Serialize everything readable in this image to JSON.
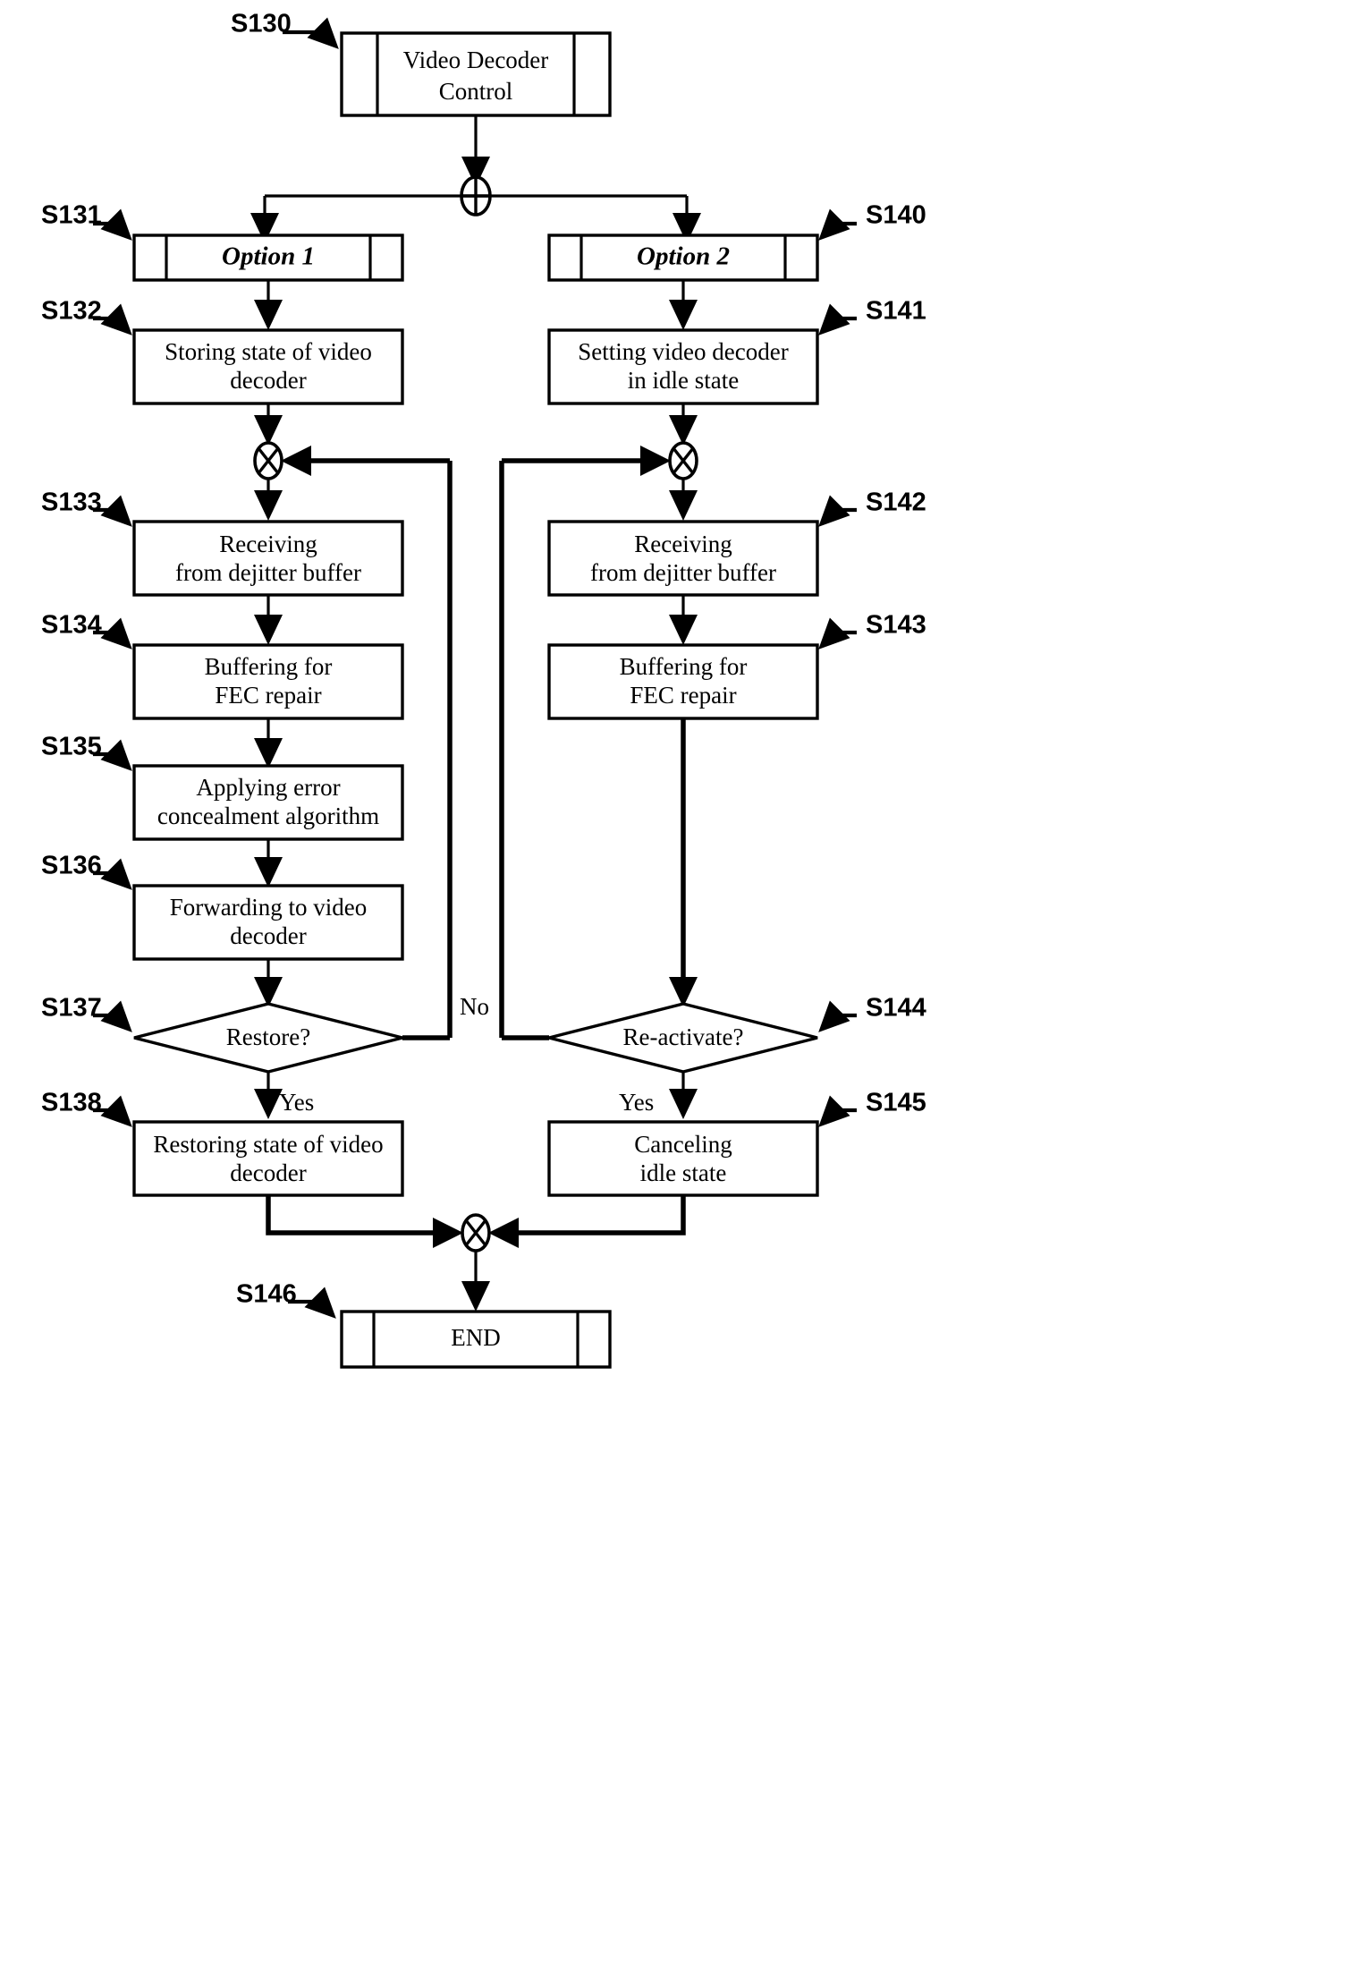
{
  "figure": {
    "type": "patent-flowchart",
    "title": "Video Decoder Control flowchart",
    "colors": {
      "stroke": "#000000",
      "fill": "#ffffff",
      "text": "#000000"
    }
  },
  "nodes": {
    "start": {
      "id": "S130",
      "label_line1": "Video Decoder",
      "label_line2": "Control",
      "shape": "terminal"
    },
    "option1": {
      "id": "S131",
      "label": "Option 1",
      "shape": "terminal"
    },
    "option2": {
      "id": "S140",
      "label": "Option 2",
      "shape": "terminal"
    },
    "store_state": {
      "id": "S132",
      "label_line1": "Storing state of video",
      "label_line2": "decoder",
      "shape": "process"
    },
    "set_idle": {
      "id": "S141",
      "label_line1": "Setting video decoder",
      "label_line2": "in idle state",
      "shape": "process"
    },
    "recv_left": {
      "id": "S133",
      "label_line1": "Receiving",
      "label_line2": "from dejitter buffer",
      "shape": "process"
    },
    "recv_right": {
      "id": "S142",
      "label_line1": "Receiving",
      "label_line2": "from dejitter buffer",
      "shape": "process"
    },
    "buffer_left": {
      "id": "S134",
      "label_line1": "Buffering for",
      "label_line2": "FEC repair",
      "shape": "process"
    },
    "buffer_right": {
      "id": "S143",
      "label_line1": "Buffering for",
      "label_line2": "FEC repair",
      "shape": "process"
    },
    "conceal": {
      "id": "S135",
      "label_line1": "Applying error",
      "label_line2": "concealment algorithm",
      "shape": "process"
    },
    "forward": {
      "id": "S136",
      "label_line1": "Forwarding to video",
      "label_line2": "decoder",
      "shape": "process"
    },
    "restore_q": {
      "id": "S137",
      "label": "Restore?",
      "shape": "decision"
    },
    "reactivate_q": {
      "id": "S144",
      "label": "Re-activate?",
      "shape": "decision"
    },
    "restore_state": {
      "id": "S138",
      "label_line1": "Restoring state of video",
      "label_line2": "decoder",
      "shape": "process"
    },
    "cancel_idle": {
      "id": "S145",
      "label_line1": "Canceling",
      "label_line2": "idle state",
      "shape": "process"
    },
    "end": {
      "id": "S146",
      "label": "END",
      "shape": "terminal"
    }
  },
  "branch_labels": {
    "no": "No",
    "yes_left": "Yes",
    "yes_right": "Yes"
  },
  "junctions": {
    "split": "circle-plus",
    "merge_left": "circle-cross",
    "merge_right": "circle-cross",
    "merge_bottom": "circle-cross"
  },
  "step_ids": [
    "S130",
    "S131",
    "S132",
    "S133",
    "S134",
    "S135",
    "S136",
    "S137",
    "S138",
    "S140",
    "S141",
    "S142",
    "S143",
    "S144",
    "S145",
    "S146"
  ]
}
